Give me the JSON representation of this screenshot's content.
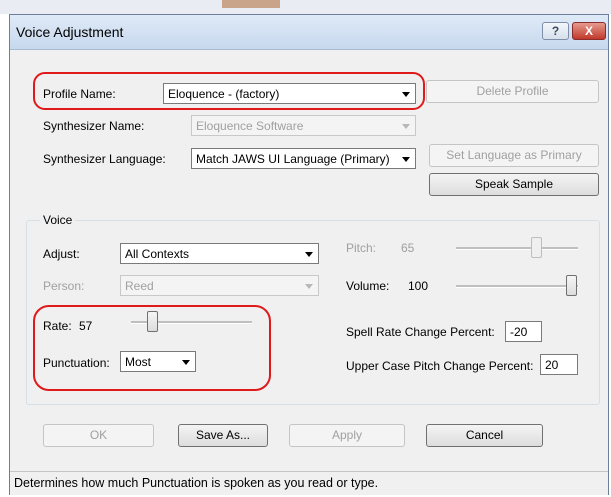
{
  "window": {
    "title": "Voice Adjustment",
    "help_label": "?",
    "close_label": "X"
  },
  "profile": {
    "label": "Profile Name:",
    "value": "Eloquence - (factory)",
    "delete_label": "Delete Profile"
  },
  "synth_name": {
    "label": "Synthesizer Name:",
    "value": "Eloquence Software"
  },
  "synth_lang": {
    "label": "Synthesizer Language:",
    "value": "Match JAWS UI Language (Primary)",
    "set_primary_label": "Set Language as Primary",
    "speak_sample_label": "Speak Sample"
  },
  "voice": {
    "group_label": "Voice",
    "adjust_label": "Adjust:",
    "adjust_value": "All Contexts",
    "person_label": "Person:",
    "person_value": "Reed",
    "pitch_label": "Pitch:",
    "pitch_value": "65",
    "volume_label": "Volume:",
    "volume_value": "100",
    "rate_label": "Rate:",
    "rate_value": "57",
    "punct_label": "Punctuation:",
    "punct_value": "Most",
    "spell_label": "Spell Rate Change Percent:",
    "spell_value": "-20",
    "upper_label": "Upper Case Pitch Change Percent:",
    "upper_value": "20"
  },
  "buttons": {
    "ok": "OK",
    "save_as": "Save As...",
    "apply": "Apply",
    "cancel": "Cancel"
  },
  "status": "Determines how much Punctuation is spoken as you read or type.",
  "colors": {
    "highlight": "#e0191b",
    "titlebar": "#c7d8ee",
    "close": "#c0392b"
  }
}
